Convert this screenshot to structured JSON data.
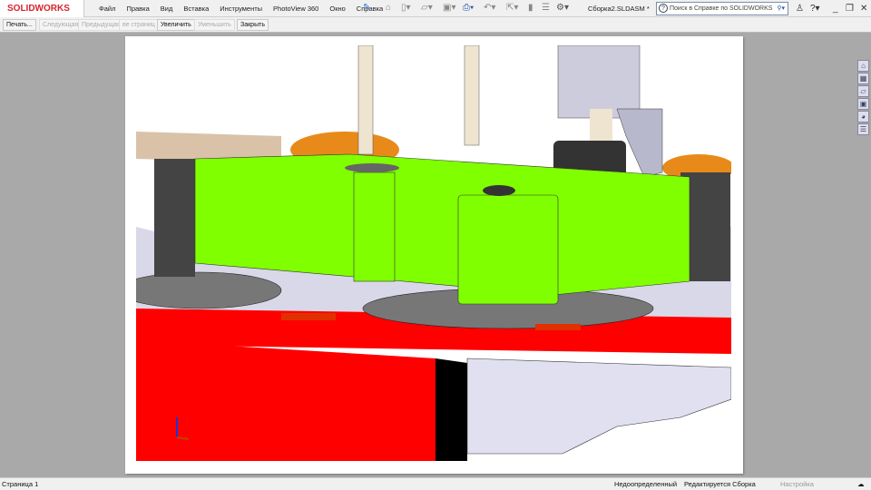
{
  "app": {
    "logo": "SOLIDWORKS",
    "document_title": "Сборка2.SLDASM *"
  },
  "menu": [
    "Файл",
    "Правка",
    "Вид",
    "Вставка",
    "Инструменты",
    "PhotoView 360",
    "Окно",
    "Справка"
  ],
  "search": {
    "placeholder": "Поиск в Справке по SOLIDWORKS"
  },
  "print_preview_toolbar": {
    "print": "Печать...",
    "next": "Следующая",
    "prev": "Предыдущая",
    "pages": "ве страниц",
    "zoom_in": "Увеличить",
    "zoom_out": "Уменьшить",
    "close": "Закрыть"
  },
  "status": {
    "page": "Страница 1",
    "state": "Недоопределенный",
    "editing": "Редактируется Сборка",
    "settings": "Настройка"
  },
  "colors": {
    "brand": "#d9232e",
    "green": "#80ff00",
    "red": "#ff0000"
  }
}
